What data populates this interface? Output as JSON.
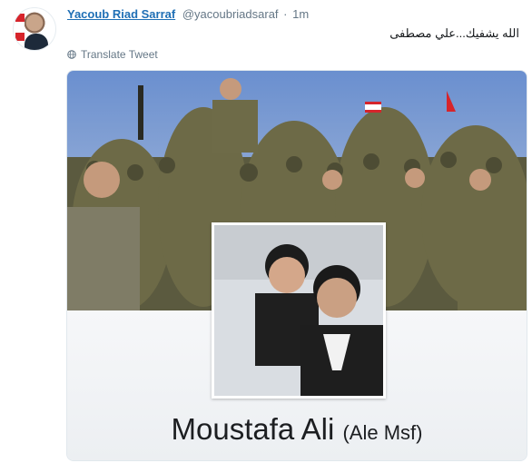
{
  "tweet": {
    "author_name": "Yacoub Riad Sarraf",
    "handle": "@yacoubriadsaraf",
    "separator": "·",
    "time": "1m",
    "text": "الله يشفيك...علي مصطفى",
    "translate_label": "Translate Tweet"
  },
  "media": {
    "profile_name": "Moustafa Ali",
    "profile_alt_name": "(Ale Msf)"
  },
  "colors": {
    "link_blue": "#1f6fb5",
    "secondary_gray": "#657786",
    "flag_red": "#d6242b"
  }
}
